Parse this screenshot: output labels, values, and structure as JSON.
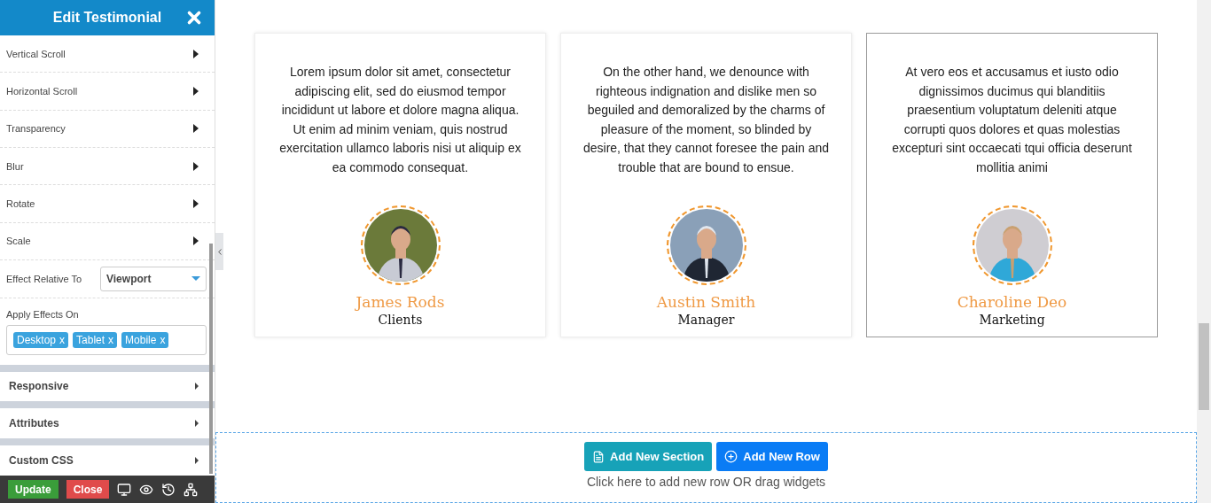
{
  "panel": {
    "title": "Edit Testimonial",
    "items": [
      {
        "label": "Vertical Scroll"
      },
      {
        "label": "Horizontal Scroll"
      },
      {
        "label": "Transparency"
      },
      {
        "label": "Blur"
      },
      {
        "label": "Rotate"
      },
      {
        "label": "Scale"
      }
    ],
    "effect_relative_to": {
      "label": "Effect Relative To",
      "value": "Viewport"
    },
    "apply_effects_on": {
      "label": "Apply Effects On",
      "tags": [
        {
          "label": "Desktop",
          "remove": "x"
        },
        {
          "label": "Tablet",
          "remove": "x"
        },
        {
          "label": "Mobile",
          "remove": "x"
        }
      ]
    },
    "sections": [
      {
        "label": "Responsive"
      },
      {
        "label": "Attributes"
      },
      {
        "label": "Custom CSS"
      }
    ],
    "footer": {
      "buttons": [
        {
          "label": "Update",
          "kind": "update"
        },
        {
          "label": "Close",
          "kind": "close"
        }
      ]
    }
  },
  "testimonials": [
    {
      "text": "Lorem ipsum dolor sit amet, consectetur adipiscing elit, sed do eiusmod tempor incididunt ut labore et dolore magna aliqua. Ut enim ad minim veniam, quis nostrud exercitation ullamco laboris nisi ut aliquip ex ea commodo consequat.",
      "name": "James Rods",
      "role": "Clients",
      "selected": false
    },
    {
      "text": "On the other hand, we denounce with righteous indignation and dislike men so beguiled and demoralized by the charms of pleasure of the moment, so blinded by desire, that they cannot foresee the pain and trouble that are bound to ensue.",
      "name": "Austin Smith",
      "role": "Manager",
      "selected": false
    },
    {
      "text": "At vero eos et accusamus et iusto odio dignissimos ducimus qui blanditiis praesentium voluptatum deleniti atque corrupti quos dolores et quas molestias excepturi sint occaecati tqui officia deserunt mollitia animi",
      "name": "Charoline Deo",
      "role": "Marketing",
      "selected": true
    }
  ],
  "add_area": {
    "buttons": [
      {
        "label": "Add New Section",
        "kind": "section"
      },
      {
        "label": "Add New Row",
        "kind": "row"
      }
    ],
    "hint": "Click here to add new row OR drag widgets"
  }
}
